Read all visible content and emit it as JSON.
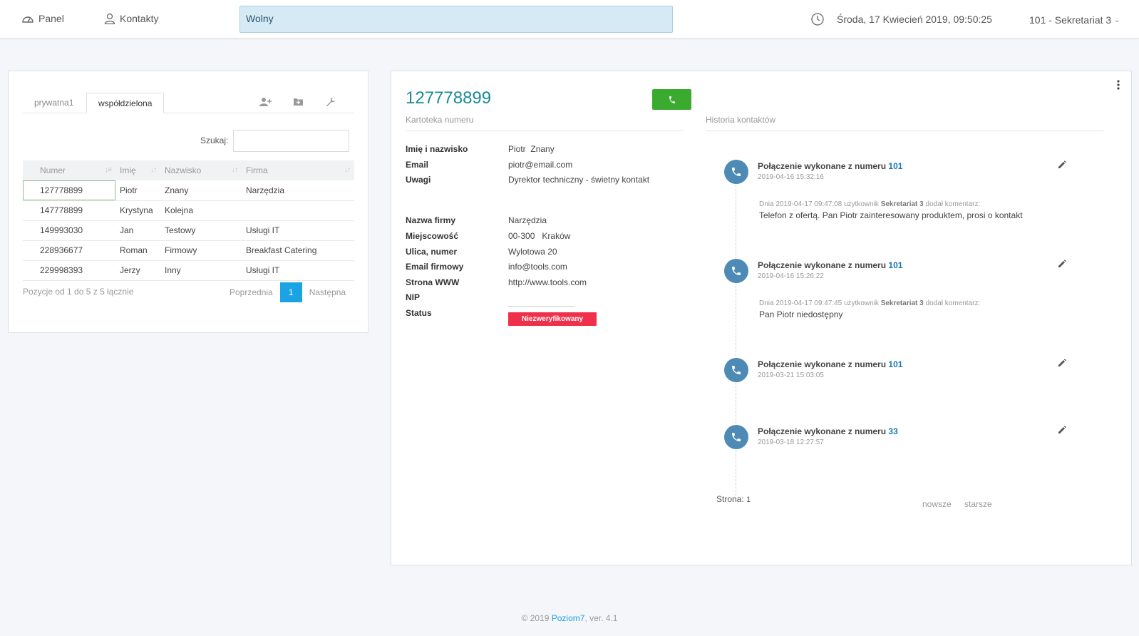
{
  "nav": {
    "panel_label": "Panel",
    "contacts_label": "Kontakty",
    "status_text": "Wolny",
    "datetime": "Środa, 17 Kwiecień 2019, 09:50:25",
    "user": "101 - Sekretariat 3"
  },
  "contacts": {
    "tabs": [
      "prywatna1",
      "współdzielona"
    ],
    "search_label": "Szukaj:",
    "search_value": "",
    "columns": [
      "Numer",
      "Imię",
      "Nazwisko",
      "Firma"
    ],
    "rows": [
      {
        "numer": "127778899",
        "imie": "Piotr",
        "nazwisko": "Znany",
        "firma": "Narzędzia"
      },
      {
        "numer": "147778899",
        "imie": "Krystyna",
        "nazwisko": "Kolejna",
        "firma": ""
      },
      {
        "numer": "149993030",
        "imie": "Jan",
        "nazwisko": "Testowy",
        "firma": "Usługi IT"
      },
      {
        "numer": "228936677",
        "imie": "Roman",
        "nazwisko": "Firmowy",
        "firma": "Breakfast Catering"
      },
      {
        "numer": "229998393",
        "imie": "Jerzy",
        "nazwisko": "Inny",
        "firma": "Usługi IT"
      }
    ],
    "pager_info": "Pozycje od 1 do 5 z 5 łącznie",
    "prev_label": "Poprzednia",
    "page_number": "1",
    "next_label": "Następna"
  },
  "card": {
    "number": "127778899",
    "card_section": "Kartoteka numeru",
    "history_section": "Historia kontaktów",
    "fields": {
      "name_label": "Imię i nazwisko",
      "first_name": "Piotr",
      "last_name": "Znany",
      "email_label": "Email",
      "email": "piotr@email.com",
      "notes_label": "Uwagi",
      "notes": "Dyrektor techniczny - świetny kontakt",
      "company_label": "Nazwa firmy",
      "company": "Narzędzia",
      "city_label": "Miejscowość",
      "postcode": "00-300",
      "city": "Kraków",
      "street_label": "Ulica, numer",
      "street": "Wylotowa 20",
      "company_email_label": "Email firmowy",
      "company_email": "info@tools.com",
      "www_label": "Strona WWW",
      "www": "http://www.tools.com",
      "nip_label": "NIP",
      "status_label": "Status",
      "status_value": "Niezweryfikowany"
    }
  },
  "history": {
    "call_prefix": "Połączenie wykonane z numeru",
    "comment_prefix": "Dnia",
    "comment_user_word": "użytkownik",
    "comment_suffix": "dodał komentarz:",
    "entries": [
      {
        "number": "101",
        "date": "2019-04-16 15:32:16",
        "comment_date": "2019-04-17 09:47:08",
        "comment_user": "Sekretariat 3",
        "comment": "Telefon z ofertą. Pan Piotr zainteresowany produktem, prosi o kontakt"
      },
      {
        "number": "101",
        "date": "2019-04-16 15:26:22",
        "comment_date": "2019-04-17 09:47:45",
        "comment_user": "Sekretariat 3",
        "comment": "Pan Piotr niedostępny"
      },
      {
        "number": "101",
        "date": "2019-03-21 15:03:05"
      },
      {
        "number": "33",
        "date": "2019-03-18 12:27:57"
      }
    ],
    "page_label": "Strona:",
    "page_value": "1",
    "newer": "nowsze",
    "older": "starsze"
  },
  "footer": {
    "prefix": "© 2019",
    "brand": "Poziom7",
    "suffix": ", ver. 4.1"
  },
  "colors": {
    "accent": "#1ca3e4",
    "number_title": "#1a8a95",
    "call_green": "#3aab2f",
    "status_red": "#f0304a",
    "timeline_icon": "#4d8ab5"
  }
}
